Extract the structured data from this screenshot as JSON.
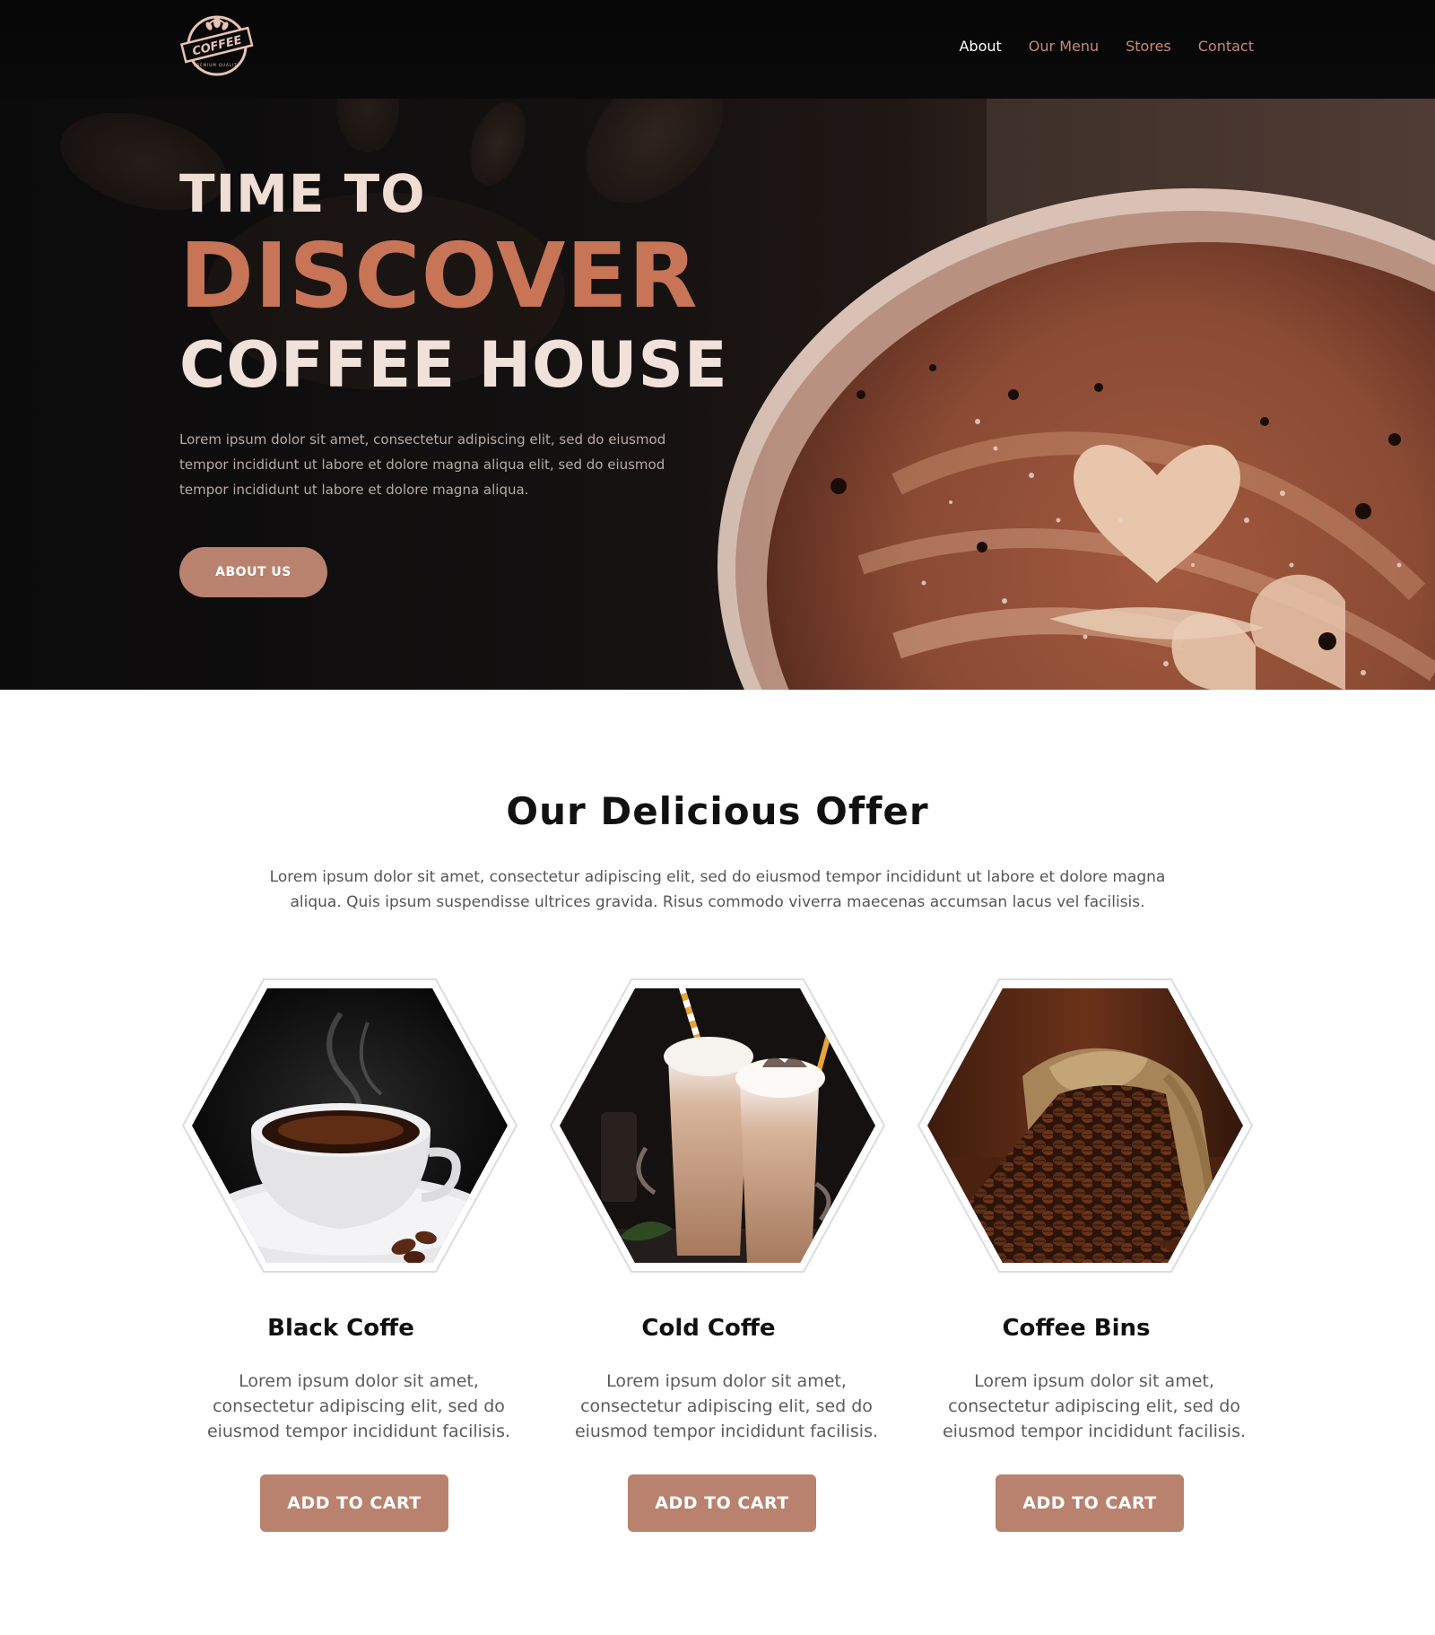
{
  "logo": {
    "text": "COFFEE",
    "subtext": "PREMIUM QUALITY"
  },
  "nav": {
    "items": [
      {
        "label": "About"
      },
      {
        "label": "Our Menu"
      },
      {
        "label": "Stores"
      },
      {
        "label": "Contact"
      }
    ]
  },
  "hero": {
    "line1": "TIME TO",
    "line2": "DISCOVER",
    "line3": "COFFEE HOUSE",
    "text": "Lorem ipsum dolor sit amet, consectetur adipiscing elit, sed do eiusmod tempor incididunt ut labore et dolore magna aliqua elit, sed do eiusmod tempor incididunt ut labore et dolore magna aliqua.",
    "button_label": "ABOUT US"
  },
  "offer": {
    "title": "Our Delicious Offer",
    "text": "Lorem ipsum dolor sit amet, consectetur adipiscing elit, sed do eiusmod tempor incididunt ut labore et dolore magna aliqua. Quis ipsum suspendisse ultrices gravida. Risus commodo viverra maecenas accumsan lacus vel facilisis.",
    "cards": [
      {
        "title": "Black Coffe",
        "text": "Lorem ipsum dolor sit amet, consectetur adipiscing elit, sed do eiusmod tempor incididunt facilisis.",
        "button_label": "ADD TO CART"
      },
      {
        "title": "Cold Coffe",
        "text": "Lorem ipsum dolor sit amet, consectetur adipiscing elit, sed do eiusmod tempor incididunt facilisis.",
        "button_label": "ADD TO CART"
      },
      {
        "title": "Coffee Bins",
        "text": "Lorem ipsum dolor sit amet, consectetur adipiscing elit, sed do eiusmod tempor incididunt facilisis.",
        "button_label": "ADD TO CART"
      }
    ]
  },
  "colors": {
    "accent": "#c77457",
    "button": "#b8826e",
    "nav_accent": "#c98a74",
    "header_bg": "#060606"
  }
}
